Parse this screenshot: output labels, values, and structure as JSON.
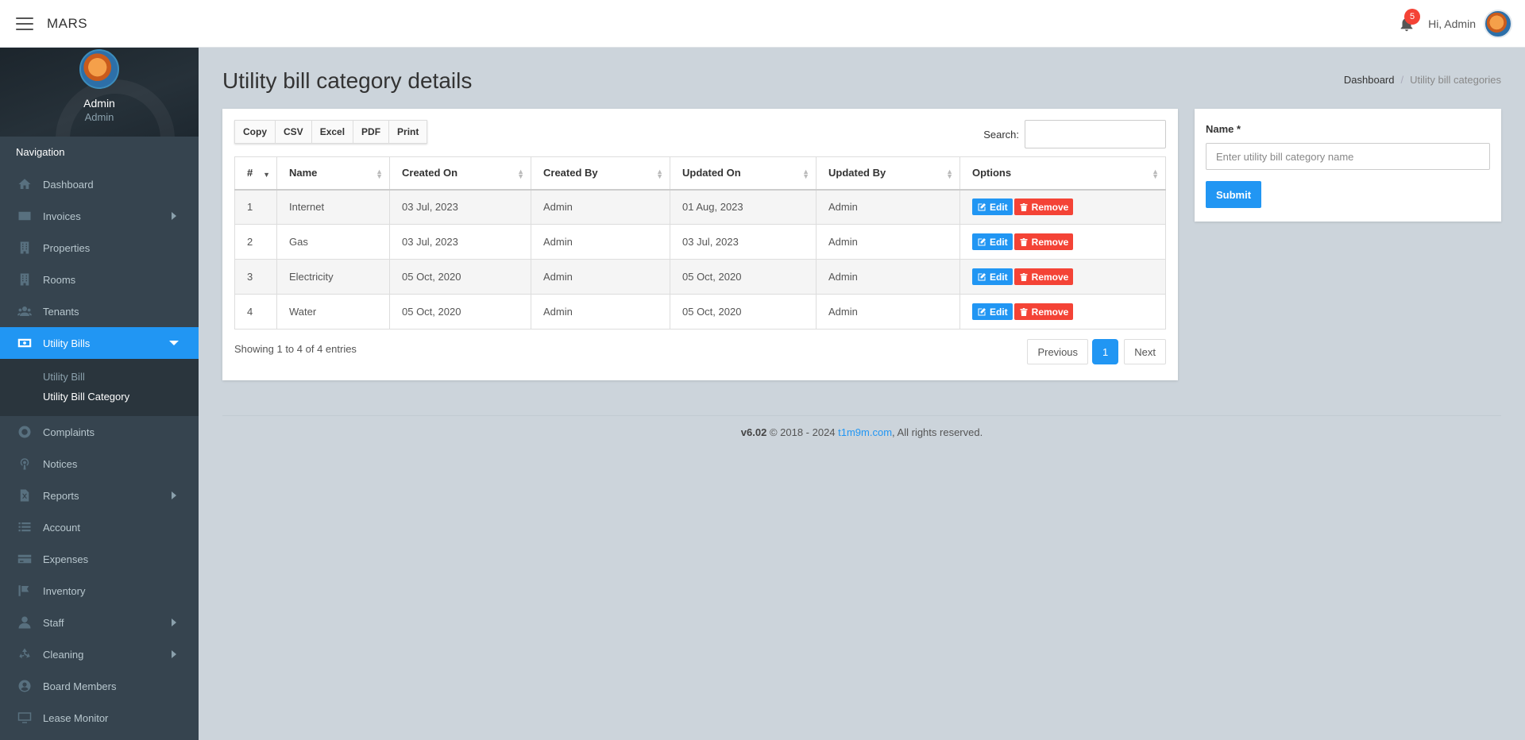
{
  "topbar": {
    "brand": "MARS",
    "notification_count": "5",
    "greeting": "Hi, Admin"
  },
  "sidebar": {
    "profile_name": "Admin",
    "profile_role": "Admin",
    "nav_header": "Navigation",
    "items": [
      {
        "label": "Dashboard",
        "icon": "dashboard-icon"
      },
      {
        "label": "Invoices",
        "icon": "invoice-icon"
      },
      {
        "label": "Properties",
        "icon": "building-icon"
      },
      {
        "label": "Rooms",
        "icon": "building-icon"
      },
      {
        "label": "Tenants",
        "icon": "users-icon"
      },
      {
        "label": "Utility Bills",
        "icon": "money-icon"
      },
      {
        "label": "Complaints",
        "icon": "support-icon"
      },
      {
        "label": "Notices",
        "icon": "podcast-icon"
      },
      {
        "label": "Reports",
        "icon": "excel-file-icon"
      },
      {
        "label": "Account",
        "icon": "list-icon"
      },
      {
        "label": "Expenses",
        "icon": "credit-card-icon"
      },
      {
        "label": "Inventory",
        "icon": "tag-icon"
      },
      {
        "label": "Staff",
        "icon": "user-icon"
      },
      {
        "label": "Cleaning",
        "icon": "recycle-icon"
      },
      {
        "label": "Board Members",
        "icon": "user-circle-icon"
      },
      {
        "label": "Lease Monitor",
        "icon": "desktop-icon"
      }
    ],
    "submenu": [
      {
        "label": "Utility Bill"
      },
      {
        "label": "Utility Bill Category"
      }
    ]
  },
  "page": {
    "title": "Utility bill category details",
    "breadcrumb": [
      {
        "label": "Dashboard"
      },
      {
        "label": "Utility bill categories"
      }
    ]
  },
  "table": {
    "buttons": [
      "Copy",
      "CSV",
      "Excel",
      "PDF",
      "Print"
    ],
    "search_label": "Search:",
    "search_value": "",
    "columns": [
      "#",
      "Name",
      "Created On",
      "Created By",
      "Updated On",
      "Updated By",
      "Options"
    ],
    "rows": [
      {
        "num": "1",
        "name": "Internet",
        "created_on": "03 Jul, 2023",
        "created_by": "Admin",
        "updated_on": "01 Aug, 2023",
        "updated_by": "Admin"
      },
      {
        "num": "2",
        "name": "Gas",
        "created_on": "03 Jul, 2023",
        "created_by": "Admin",
        "updated_on": "03 Jul, 2023",
        "updated_by": "Admin"
      },
      {
        "num": "3",
        "name": "Electricity",
        "created_on": "05 Oct, 2020",
        "created_by": "Admin",
        "updated_on": "05 Oct, 2020",
        "updated_by": "Admin"
      },
      {
        "num": "4",
        "name": "Water",
        "created_on": "05 Oct, 2020",
        "created_by": "Admin",
        "updated_on": "05 Oct, 2020",
        "updated_by": "Admin"
      }
    ],
    "edit_label": "Edit",
    "remove_label": "Remove",
    "info": "Showing 1 to 4 of 4 entries",
    "pager": {
      "previous": "Previous",
      "current": "1",
      "next": "Next"
    }
  },
  "form": {
    "name_label": "Name *",
    "name_placeholder": "Enter utility bill category name",
    "name_value": "",
    "submit_label": "Submit"
  },
  "footer": {
    "version": "v6.02",
    "copyright": " © 2018 - 2024 ",
    "link": "t1m9m.com",
    "rights": ", All rights reserved."
  },
  "colors": {
    "accent": "#2196f3",
    "danger": "#f44336",
    "sidebar": "#36444f",
    "background": "#ccd4db"
  }
}
